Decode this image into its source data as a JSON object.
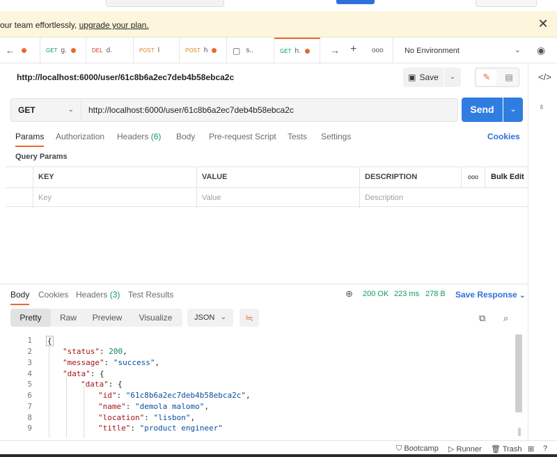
{
  "banner": {
    "text": "our team effortlessly, ",
    "link": "upgrade your plan."
  },
  "tabs": [
    {
      "method": "GET",
      "title": "g."
    },
    {
      "method": "DEL",
      "title": "d."
    },
    {
      "method": "POST",
      "title": "l"
    },
    {
      "method": "POST",
      "title": "h"
    },
    {
      "method": "",
      "title": "s.."
    },
    {
      "method": "GET",
      "title": "h."
    }
  ],
  "environment": "No Environment",
  "request": {
    "title": "http://localhost:6000/user/61c8b6a2ec7deb4b58ebca2c",
    "save_label": "Save",
    "method": "GET",
    "url": "http://localhost:6000/user/61c8b6a2ec7deb4b58ebca2c",
    "send_label": "Send"
  },
  "request_tabs": {
    "params": "Params",
    "authorization": "Authorization",
    "headers": "Headers",
    "headers_count": "(6)",
    "body": "Body",
    "prerequest": "Pre-request Script",
    "tests": "Tests",
    "settings": "Settings",
    "cookies": "Cookies"
  },
  "query_params": {
    "title": "Query Params",
    "columns": [
      "KEY",
      "VALUE",
      "DESCRIPTION"
    ],
    "more": "ooo",
    "bulk_edit": "Bulk Edit",
    "placeholders": [
      "Key",
      "Value",
      "Description"
    ]
  },
  "response": {
    "tabs": {
      "body": "Body",
      "cookies": "Cookies",
      "headers": "Headers",
      "headers_count": "(3)",
      "test_results": "Test Results"
    },
    "status": "200 OK",
    "time": "223 ms",
    "size": "278 B",
    "save_response": "Save Response",
    "views": [
      "Pretty",
      "Raw",
      "Preview",
      "Visualize"
    ],
    "format": "JSON"
  },
  "code_lines": [
    {
      "n": "1",
      "text": "{"
    },
    {
      "n": "2",
      "key": "\"status\"",
      "sep": ": ",
      "num": "200",
      "tail": ","
    },
    {
      "n": "3",
      "key": "\"message\"",
      "sep": ": ",
      "str": "\"success\"",
      "tail": ","
    },
    {
      "n": "4",
      "key": "\"data\"",
      "sep": ": ",
      "tail": "{"
    },
    {
      "n": "5",
      "key": "\"data\"",
      "sep": ": ",
      "tail": "{"
    },
    {
      "n": "6",
      "key": "\"id\"",
      "sep": ": ",
      "str": "\"61c8b6a2ec7deb4b58ebca2c\"",
      "tail": ","
    },
    {
      "n": "7",
      "key": "\"name\"",
      "sep": ": ",
      "str": "\"demola malomo\"",
      "tail": ","
    },
    {
      "n": "8",
      "key": "\"location\"",
      "sep": ": ",
      "str": "\"lisbon\"",
      "tail": ","
    },
    {
      "n": "9",
      "key": "\"title\"",
      "sep": ": ",
      "str": "\"product engineer\"",
      "tail": ""
    }
  ],
  "bottom": {
    "bootcamp": "Bootcamp",
    "runner": "Runner",
    "trash": "Trash"
  }
}
